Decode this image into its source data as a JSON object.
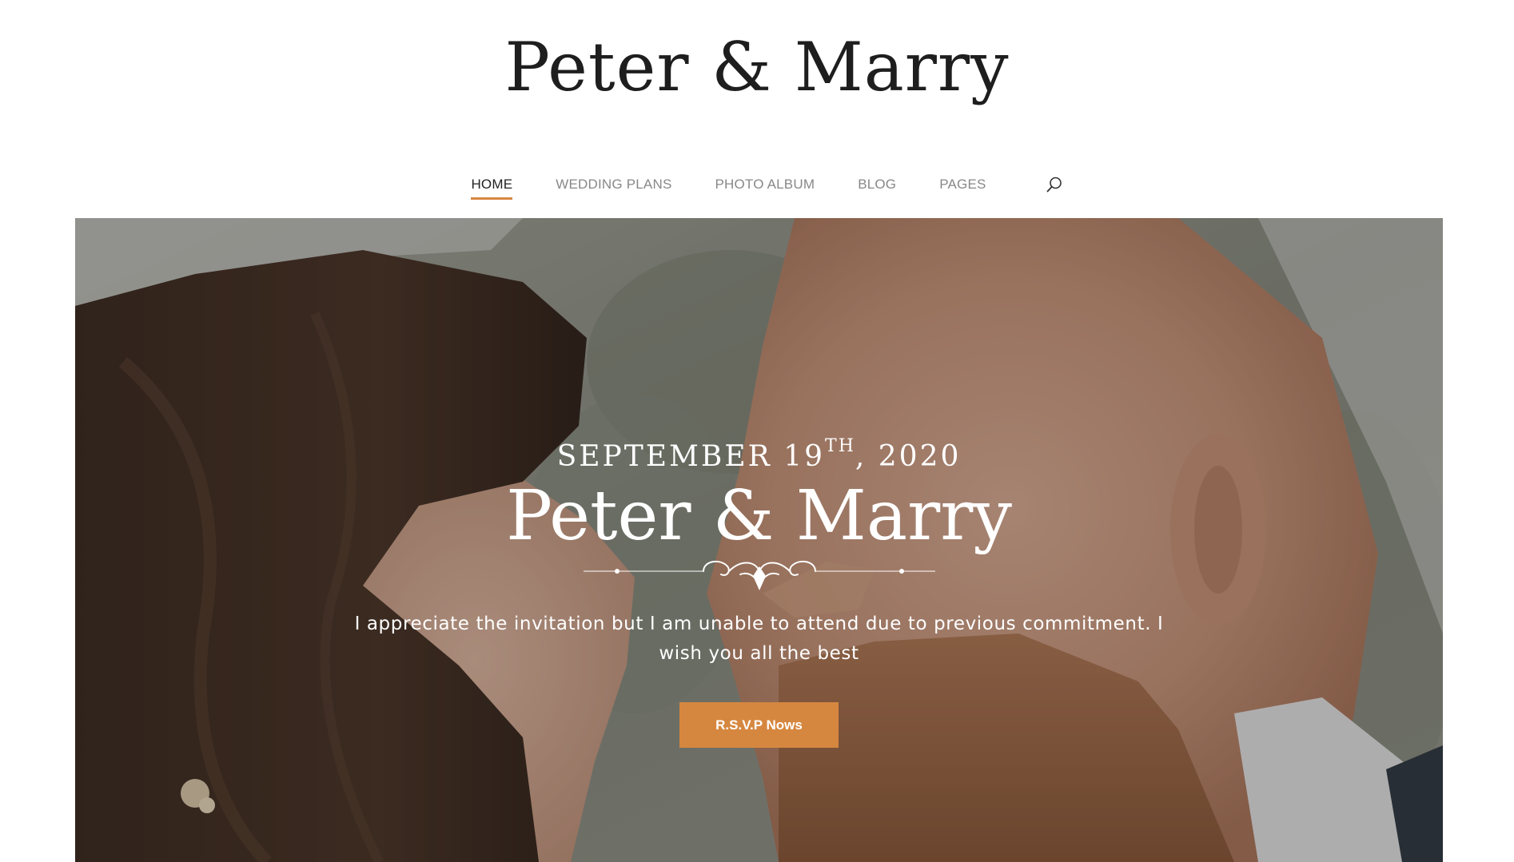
{
  "header": {
    "logo_text": "Peter & Marry"
  },
  "nav": {
    "items": [
      {
        "label": "HOME",
        "active": true
      },
      {
        "label": "WEDDING PLANS",
        "active": false
      },
      {
        "label": "PHOTO ALBUM",
        "active": false
      },
      {
        "label": "BLOG",
        "active": false
      },
      {
        "label": "PAGES",
        "active": false
      }
    ],
    "search_icon": "search-icon"
  },
  "hero": {
    "date_main": "SEPTEMBER 19",
    "date_suffix": "TH",
    "date_year": ", 2020",
    "title": "Peter & Marry",
    "ornament_icon": "flourish-divider",
    "text": "I appreciate the invitation but I am unable to attend due to previous commitment. I wish you all the best",
    "button_label": "R.S.V.P Nows"
  },
  "colors": {
    "accent": "#d6873f",
    "text_dark": "#1e1e1e",
    "nav_inactive": "#888888"
  }
}
